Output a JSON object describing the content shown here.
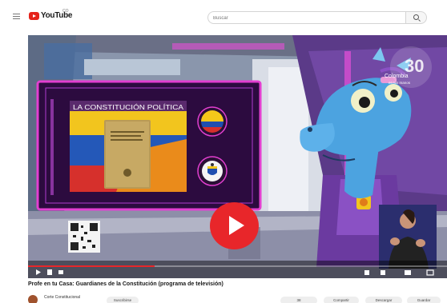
{
  "header": {
    "logo_text": "YouTube",
    "region_label": "CO",
    "search_placeholder": "Buscar"
  },
  "video": {
    "overlay_heading": "LA CONSTITUCIÓN POLÍTICA",
    "corner_logo_label": "Colombia",
    "corner_logo_sublabel": "en tus manos",
    "title": "Profe en tu Casa: Guardianes de la Constitución (programa de televisión)"
  },
  "channel": {
    "name": "Corte Constitucional",
    "subscribe_label": "Suscribirse"
  },
  "actions": {
    "like_count": "38",
    "share_label": "Compartir",
    "download_label": "Descargar",
    "save_label": "Guardar"
  },
  "colors": {
    "play_button": "#e8262a",
    "character": "#4ca3e0",
    "overlay_frame": "#e23fd0"
  }
}
